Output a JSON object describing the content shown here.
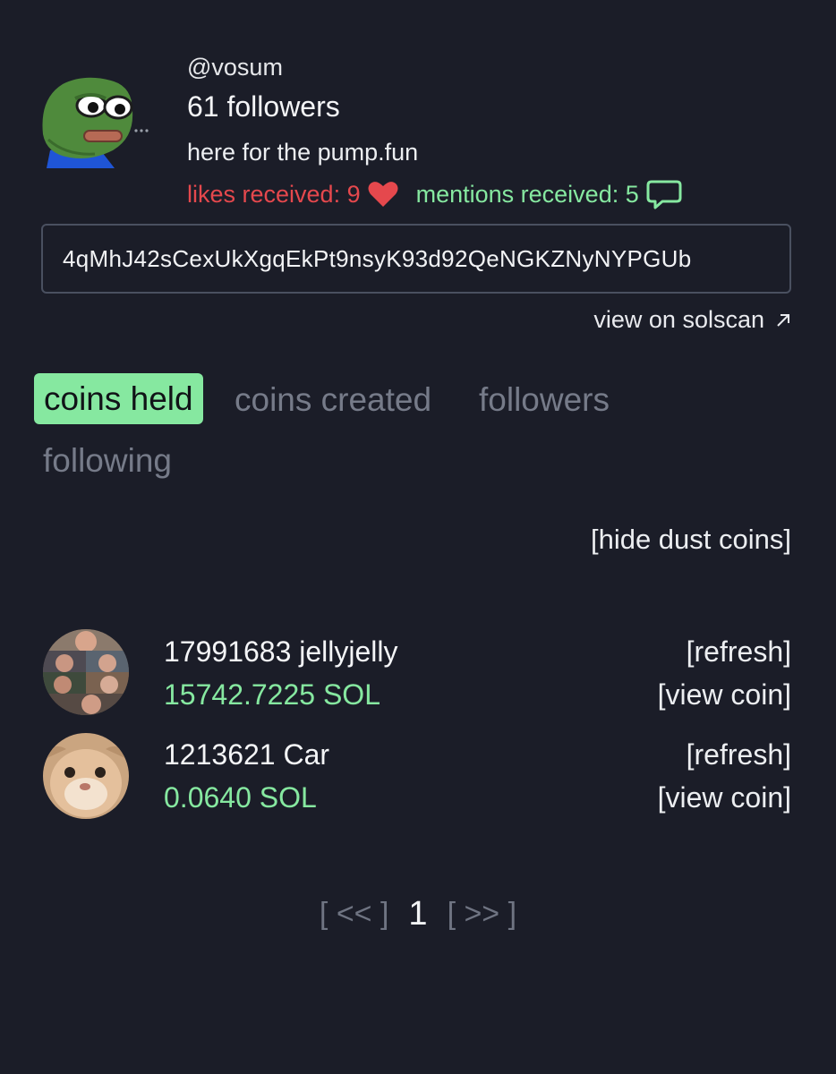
{
  "profile": {
    "handle": "@vosum",
    "followers": "61 followers",
    "bio": "here for the pump.fun",
    "likes_label": "likes received: 9",
    "mentions_label": "mentions received: 5",
    "address": "4qMhJ42sCexUkXgqEkPt9nsyK93d92QeNGKZNyNYPGUb",
    "solscan_link": "view on solscan"
  },
  "tabs": [
    {
      "label": "coins held",
      "active": true
    },
    {
      "label": "coins created",
      "active": false
    },
    {
      "label": "followers",
      "active": false
    },
    {
      "label": "following",
      "active": false
    }
  ],
  "hide_dust": "[hide dust coins]",
  "coins": [
    {
      "name": "17991683 jellyjelly",
      "balance": "15742.7225 SOL",
      "refresh": "[refresh]",
      "view": "[view coin]"
    },
    {
      "name": "1213621 Car",
      "balance": "0.0640 SOL",
      "refresh": "[refresh]",
      "view": "[view coin]"
    }
  ],
  "pagination": {
    "prev": "[ << ]",
    "current": "1",
    "next": "[ >> ]"
  },
  "colors": {
    "background": "#1b1d28",
    "accent_green": "#86e8a0",
    "likes_red": "#e5484d",
    "muted_tab": "#767b89"
  }
}
